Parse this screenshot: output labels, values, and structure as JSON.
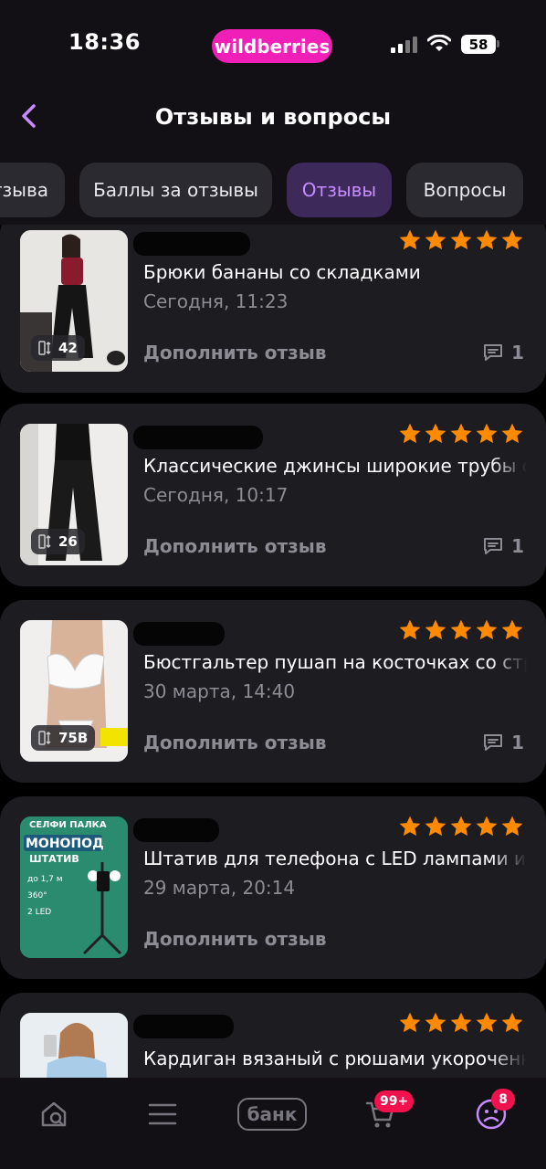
{
  "status_bar": {
    "time": "18:36",
    "brand": "wildberries",
    "battery": "58"
  },
  "header": {
    "title": "Отзывы и вопросы"
  },
  "tabs": [
    {
      "label": "тзыва",
      "active": false
    },
    {
      "label": "Баллы за отзывы",
      "active": false
    },
    {
      "label": "Отзывы",
      "active": true
    },
    {
      "label": "Вопросы",
      "active": false
    }
  ],
  "reviews": [
    {
      "product": "Брюки бананы со складками",
      "date": "Сегодня, 11:23",
      "size": "42",
      "stars": 5,
      "action": "Дополнить отзыв",
      "comments": "1"
    },
    {
      "product": "Классические джинсы широкие трубы с",
      "date": "Сегодня, 10:17",
      "size": "26",
      "stars": 5,
      "action": "Дополнить отзыв",
      "comments": "1"
    },
    {
      "product": "Бюстгальтер пушап на косточках со стр",
      "date": "30 марта, 14:40",
      "size": "75B",
      "stars": 5,
      "action": "Дополнить отзыв",
      "comments": "1"
    },
    {
      "product": "Штатив для телефона с LED лампами и",
      "date": "29 марта, 20:14",
      "size": "",
      "stars": 5,
      "action": "Дополнить отзыв",
      "comments": ""
    },
    {
      "product": "Кардиган вязаный с рюшами укороченн",
      "date": "",
      "size": "",
      "stars": 5,
      "action": "",
      "comments": ""
    }
  ],
  "thumb3_text": {
    "top": "СЕЛФИ ПАЛКА",
    "line1": "МОНОПОД",
    "line2": "ШТАТИВ",
    "spec1": "до 1,7 м",
    "spec2": "360°",
    "spec3": "2 LED"
  },
  "bottom_nav": {
    "bank_label": "банк",
    "cart_badge": "99+",
    "profile_badge": "8"
  },
  "colors": {
    "accent": "#c58bff",
    "brand": "#f01fb8",
    "star": "#ff8a00",
    "badge": "#f1114d"
  }
}
